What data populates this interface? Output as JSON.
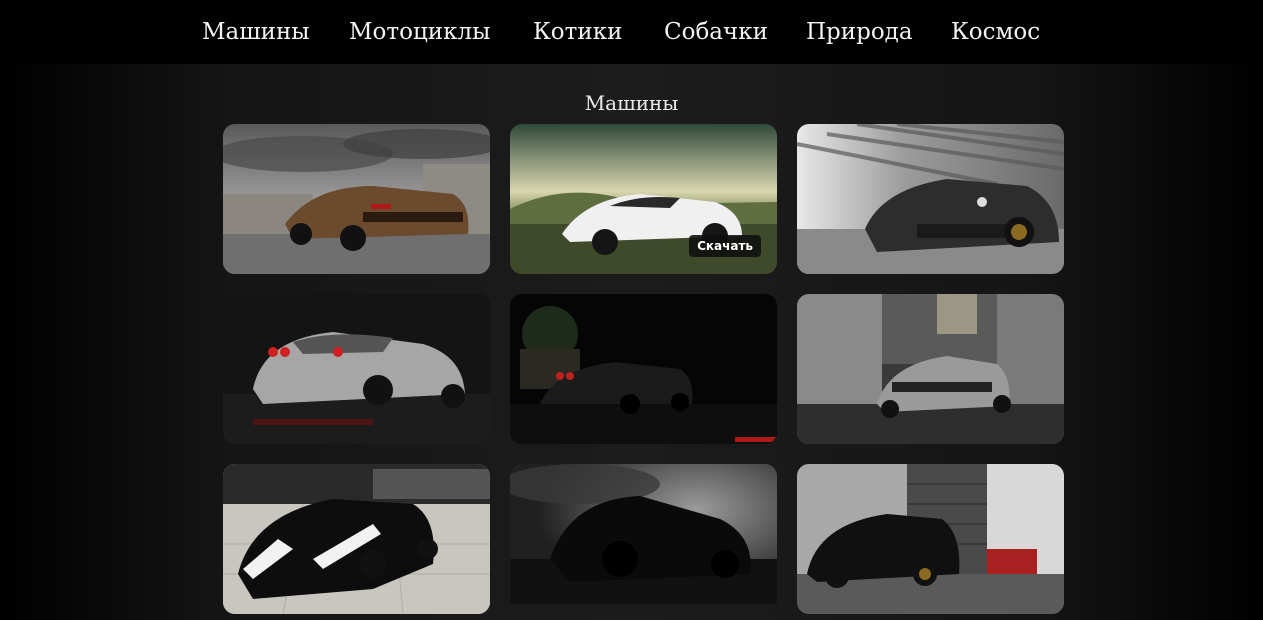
{
  "nav": {
    "items": [
      {
        "label": "Машины"
      },
      {
        "label": "Мотоциклы"
      },
      {
        "label": "Котики"
      },
      {
        "label": "Собачки"
      },
      {
        "label": "Природа"
      },
      {
        "label": "Космос"
      }
    ]
  },
  "section": {
    "title": "Машины"
  },
  "gallery": {
    "download_label": "Скачать",
    "images": [
      {
        "subject": "bronze-supercar-cloudy"
      },
      {
        "subject": "white-supercar-field"
      },
      {
        "subject": "grey-supercar-tunnel"
      },
      {
        "subject": "silver-coupe-studio"
      },
      {
        "subject": "black-coupe-night"
      },
      {
        "subject": "grey-coupe-alley"
      },
      {
        "subject": "black-white-supercar"
      },
      {
        "subject": "black-car-storm"
      },
      {
        "subject": "black-sedan-garage"
      }
    ]
  }
}
